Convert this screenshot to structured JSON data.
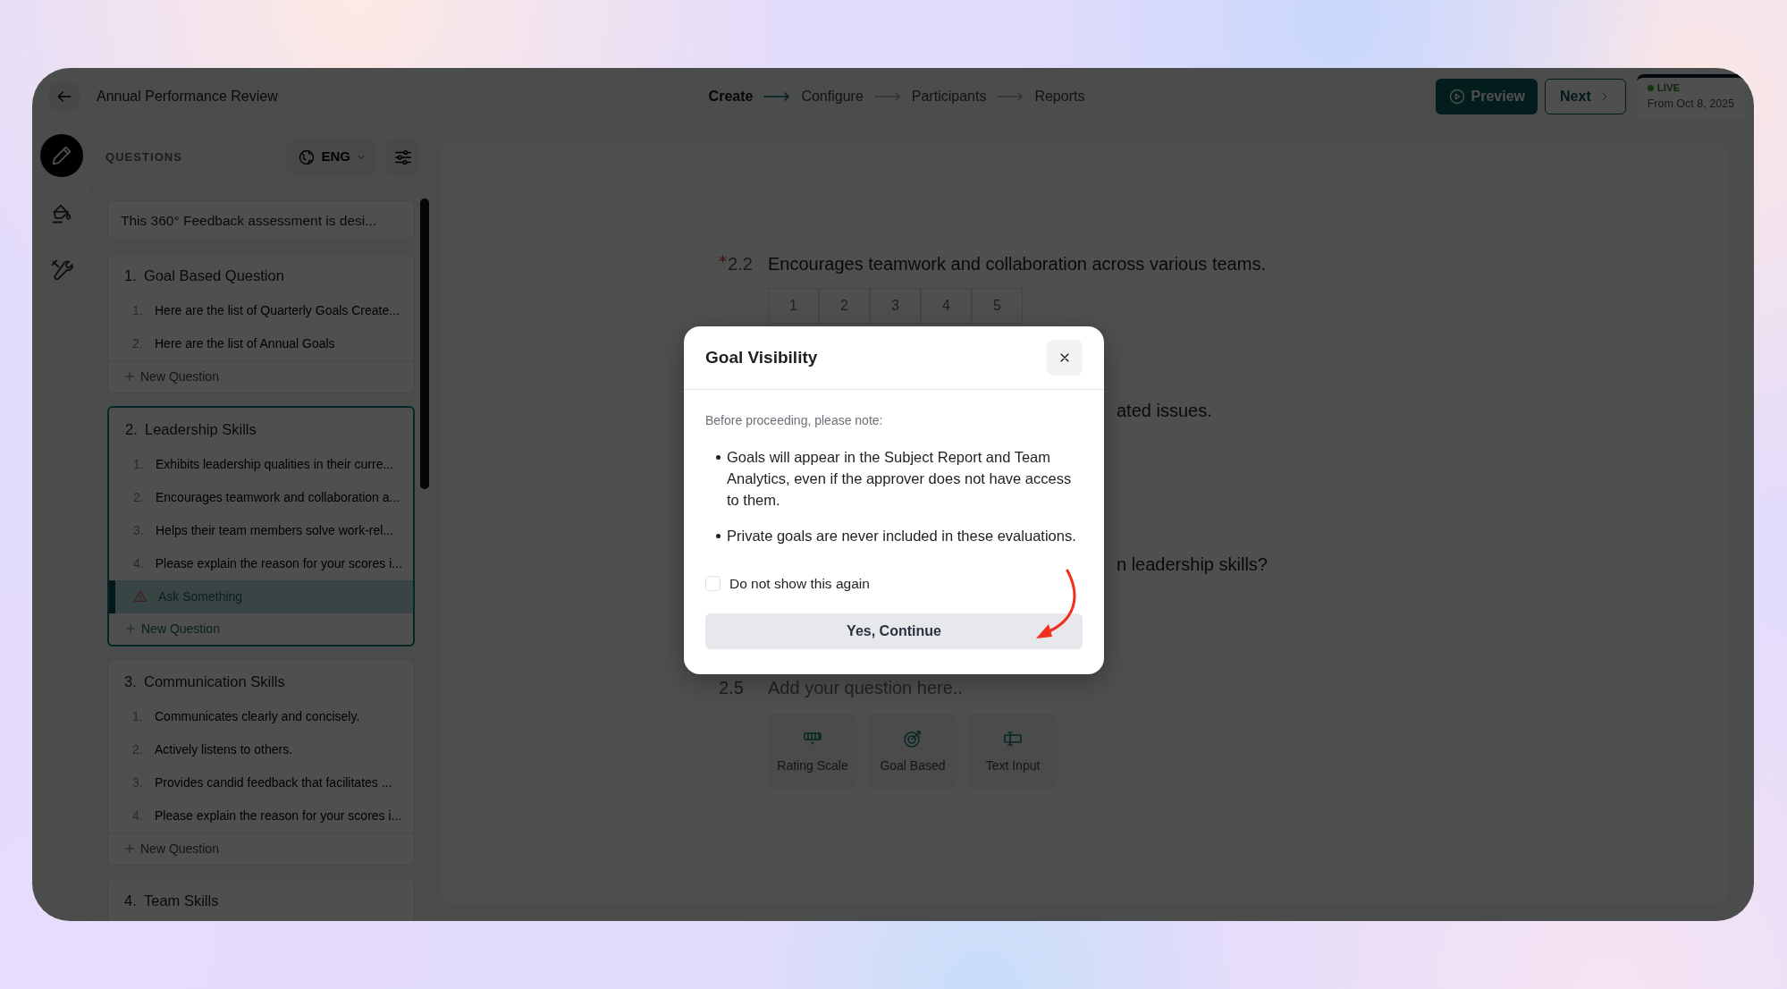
{
  "window": {
    "title": "Annual Performance Review"
  },
  "steps": [
    {
      "label": "Create",
      "selected": true
    },
    {
      "label": "Configure",
      "selected": false
    },
    {
      "label": "Participants",
      "selected": false
    },
    {
      "label": "Reports",
      "selected": false
    }
  ],
  "header_actions": {
    "preview": "Preview",
    "next": "Next",
    "status": {
      "label": "LIVE",
      "date": "From Oct 8, 2025"
    }
  },
  "rail": [
    {
      "kind": "edit",
      "selected": true
    },
    {
      "kind": "theme",
      "selected": false
    },
    {
      "kind": "tools",
      "selected": false
    }
  ],
  "questions_panel": {
    "heading": "QUESTIONS",
    "language": "ENG",
    "intro": "This 360° Feedback assessment is desi...",
    "sections": [
      {
        "number": "1.",
        "title": "Goal Based Question",
        "selected": false,
        "add_label": "New Question",
        "items": [
          {
            "number": "1.",
            "text": "Here are the list of Quarterly Goals Create...",
            "selected": false,
            "warning": false
          },
          {
            "number": "2.",
            "text": "Here are the list of Annual Goals",
            "selected": false,
            "warning": false
          }
        ]
      },
      {
        "number": "2.",
        "title": "Leadership Skills",
        "selected": true,
        "add_label": "New Question",
        "items": [
          {
            "number": "1.",
            "text": "Exhibits leadership qualities in their curre...",
            "selected": false,
            "warning": false
          },
          {
            "number": "2.",
            "text": "Encourages teamwork and collaboration a...",
            "selected": false,
            "warning": false
          },
          {
            "number": "3.",
            "text": "Helps their team members solve work-rel...",
            "selected": false,
            "warning": false
          },
          {
            "number": "4.",
            "text": "Please explain the reason for your scores i...",
            "selected": false,
            "warning": false
          },
          {
            "text": "Ask Something",
            "selected": true,
            "warning": true
          }
        ]
      },
      {
        "number": "3.",
        "title": "Communication Skills",
        "selected": false,
        "add_label": "New Question",
        "items": [
          {
            "number": "1.",
            "text": "Communicates clearly and concisely.",
            "selected": false,
            "warning": false
          },
          {
            "number": "2.",
            "text": "Actively listens to others.",
            "selected": false,
            "warning": false
          },
          {
            "number": "3.",
            "text": "Provides candid feedback that facilitates ...",
            "selected": false,
            "warning": false
          },
          {
            "number": "4.",
            "text": "Please explain the reason for your scores i...",
            "selected": false,
            "warning": false
          }
        ]
      },
      {
        "number": "4.",
        "title": "Team Skills",
        "selected": false
      }
    ]
  },
  "editor": {
    "questions": [
      {
        "number": "2.2",
        "text": "Encourages teamwork and collaboration across various teams.",
        "required": true,
        "scale": [
          "1",
          "2",
          "3",
          "4",
          "5"
        ]
      },
      {
        "text": "ated issues."
      },
      {
        "text": "n leadership skills?"
      },
      {
        "number": "2.5",
        "placeholder": "Add your question here..",
        "required": false
      }
    ],
    "question_types": [
      {
        "kind": "rating",
        "label": "Rating Scale"
      },
      {
        "kind": "goal",
        "label": "Goal Based"
      },
      {
        "kind": "text",
        "label": "Text Input"
      }
    ]
  },
  "dialog": {
    "title": "Goal Visibility",
    "intro": "Before proceeding, please note:",
    "points": [
      "Goals will appear in the Subject Report and Team Analytics, even if the approver does not have access to them.",
      "Private goals are never included in these evaluations."
    ],
    "checkbox": {
      "label": "Do not show this again",
      "checked": false
    },
    "confirm": "Yes, Continue"
  }
}
